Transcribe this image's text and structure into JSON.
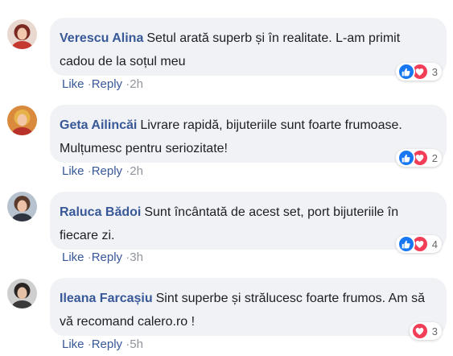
{
  "comments": [
    {
      "author": "Verescu Alina",
      "text": "Setul arată superb și în realitate. L-am primit cadou de la soțul meu",
      "reactions": {
        "types": [
          "like-icon",
          "love-icon"
        ],
        "count": "3"
      },
      "like_label": "Like",
      "reply_label": "Reply",
      "separator": "·",
      "time": "2h"
    },
    {
      "author": "Geta Ailincăi",
      "text": "Livrare rapidă, bijuteriile sunt foarte frumoase. Mulțumesc pentru seriozitate!",
      "reactions": {
        "types": [
          "like-icon",
          "love-icon"
        ],
        "count": "2"
      },
      "like_label": "Like",
      "reply_label": "Reply",
      "separator": "·",
      "time": "2h"
    },
    {
      "author": "Raluca Bădoi",
      "text": "Sunt încântată de acest set, port bijuteriile în fiecare zi.",
      "reactions": {
        "types": [
          "like-icon",
          "love-icon"
        ],
        "count": "4"
      },
      "like_label": "Like",
      "reply_label": "Reply",
      "separator": "·",
      "time": "3h"
    },
    {
      "author": "Ileana Farcașiu",
      "text": "Sint superbe și strălucesc foarte frumos. Am să vă recomand calero.ro !",
      "reactions": {
        "types": [
          "love-icon"
        ],
        "count": "3"
      },
      "like_label": "Like",
      "reply_label": "Reply",
      "separator": "·",
      "time": "5h"
    }
  ],
  "colors": {
    "bubble_bg": "#f0f2f5",
    "author": "#385898",
    "text": "#1c1e21",
    "like_blue": "#1877f2",
    "love_red": "#f33e58",
    "meta_gray": "#90949c"
  }
}
